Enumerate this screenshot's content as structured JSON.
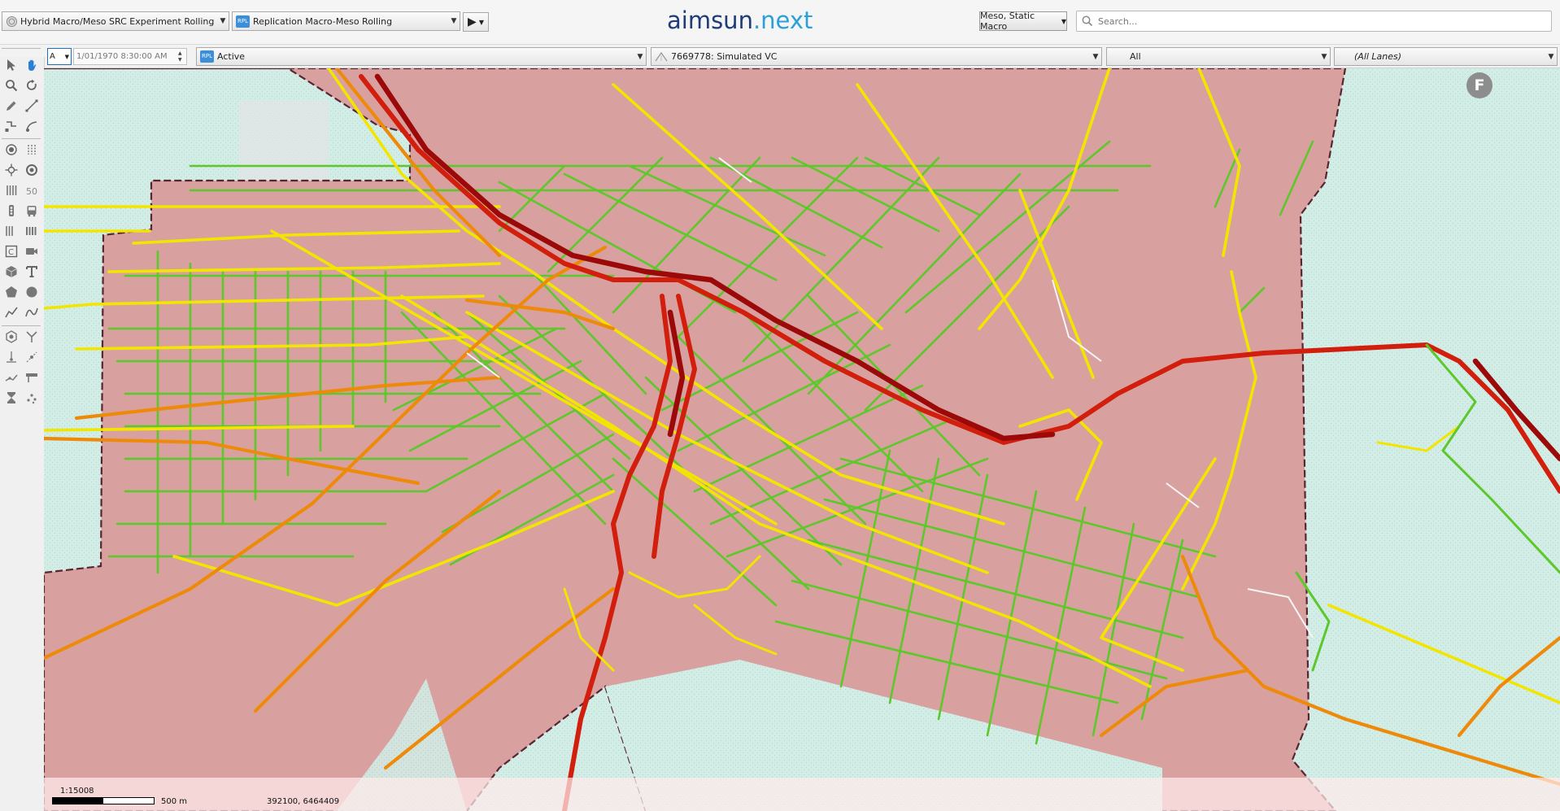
{
  "header": {
    "experiment": "Hybrid Macro/Meso SRC Experiment Rolling (Rollin",
    "replication_badge": "RPL",
    "replication": "Replication Macro-Meso Rolling",
    "logo_main": "aimsun",
    "logo_dot": ".",
    "logo_next": "next",
    "mode": "Meso, Static Macro",
    "search_placeholder": "Search..."
  },
  "secondary": {
    "layer": "A",
    "datetime": "1/01/1970 8:30:00 AM",
    "status_badge": "RPL",
    "status": "Active",
    "mode_value": "7669778: Simulated VC",
    "filter": "All",
    "lanes": "(All Lanes)"
  },
  "map": {
    "badge": "F",
    "scale": "1:15008",
    "scale_unit": "500 m",
    "coordinates": "392100, 6464409"
  },
  "colors": {
    "area_fill": "#d9a0a0",
    "water": "#d2ece6",
    "green": "#5cc82a",
    "yellow": "#f2e600",
    "orange": "#ee8a0a",
    "red": "#d21e0c",
    "darkred": "#9b0a08"
  }
}
